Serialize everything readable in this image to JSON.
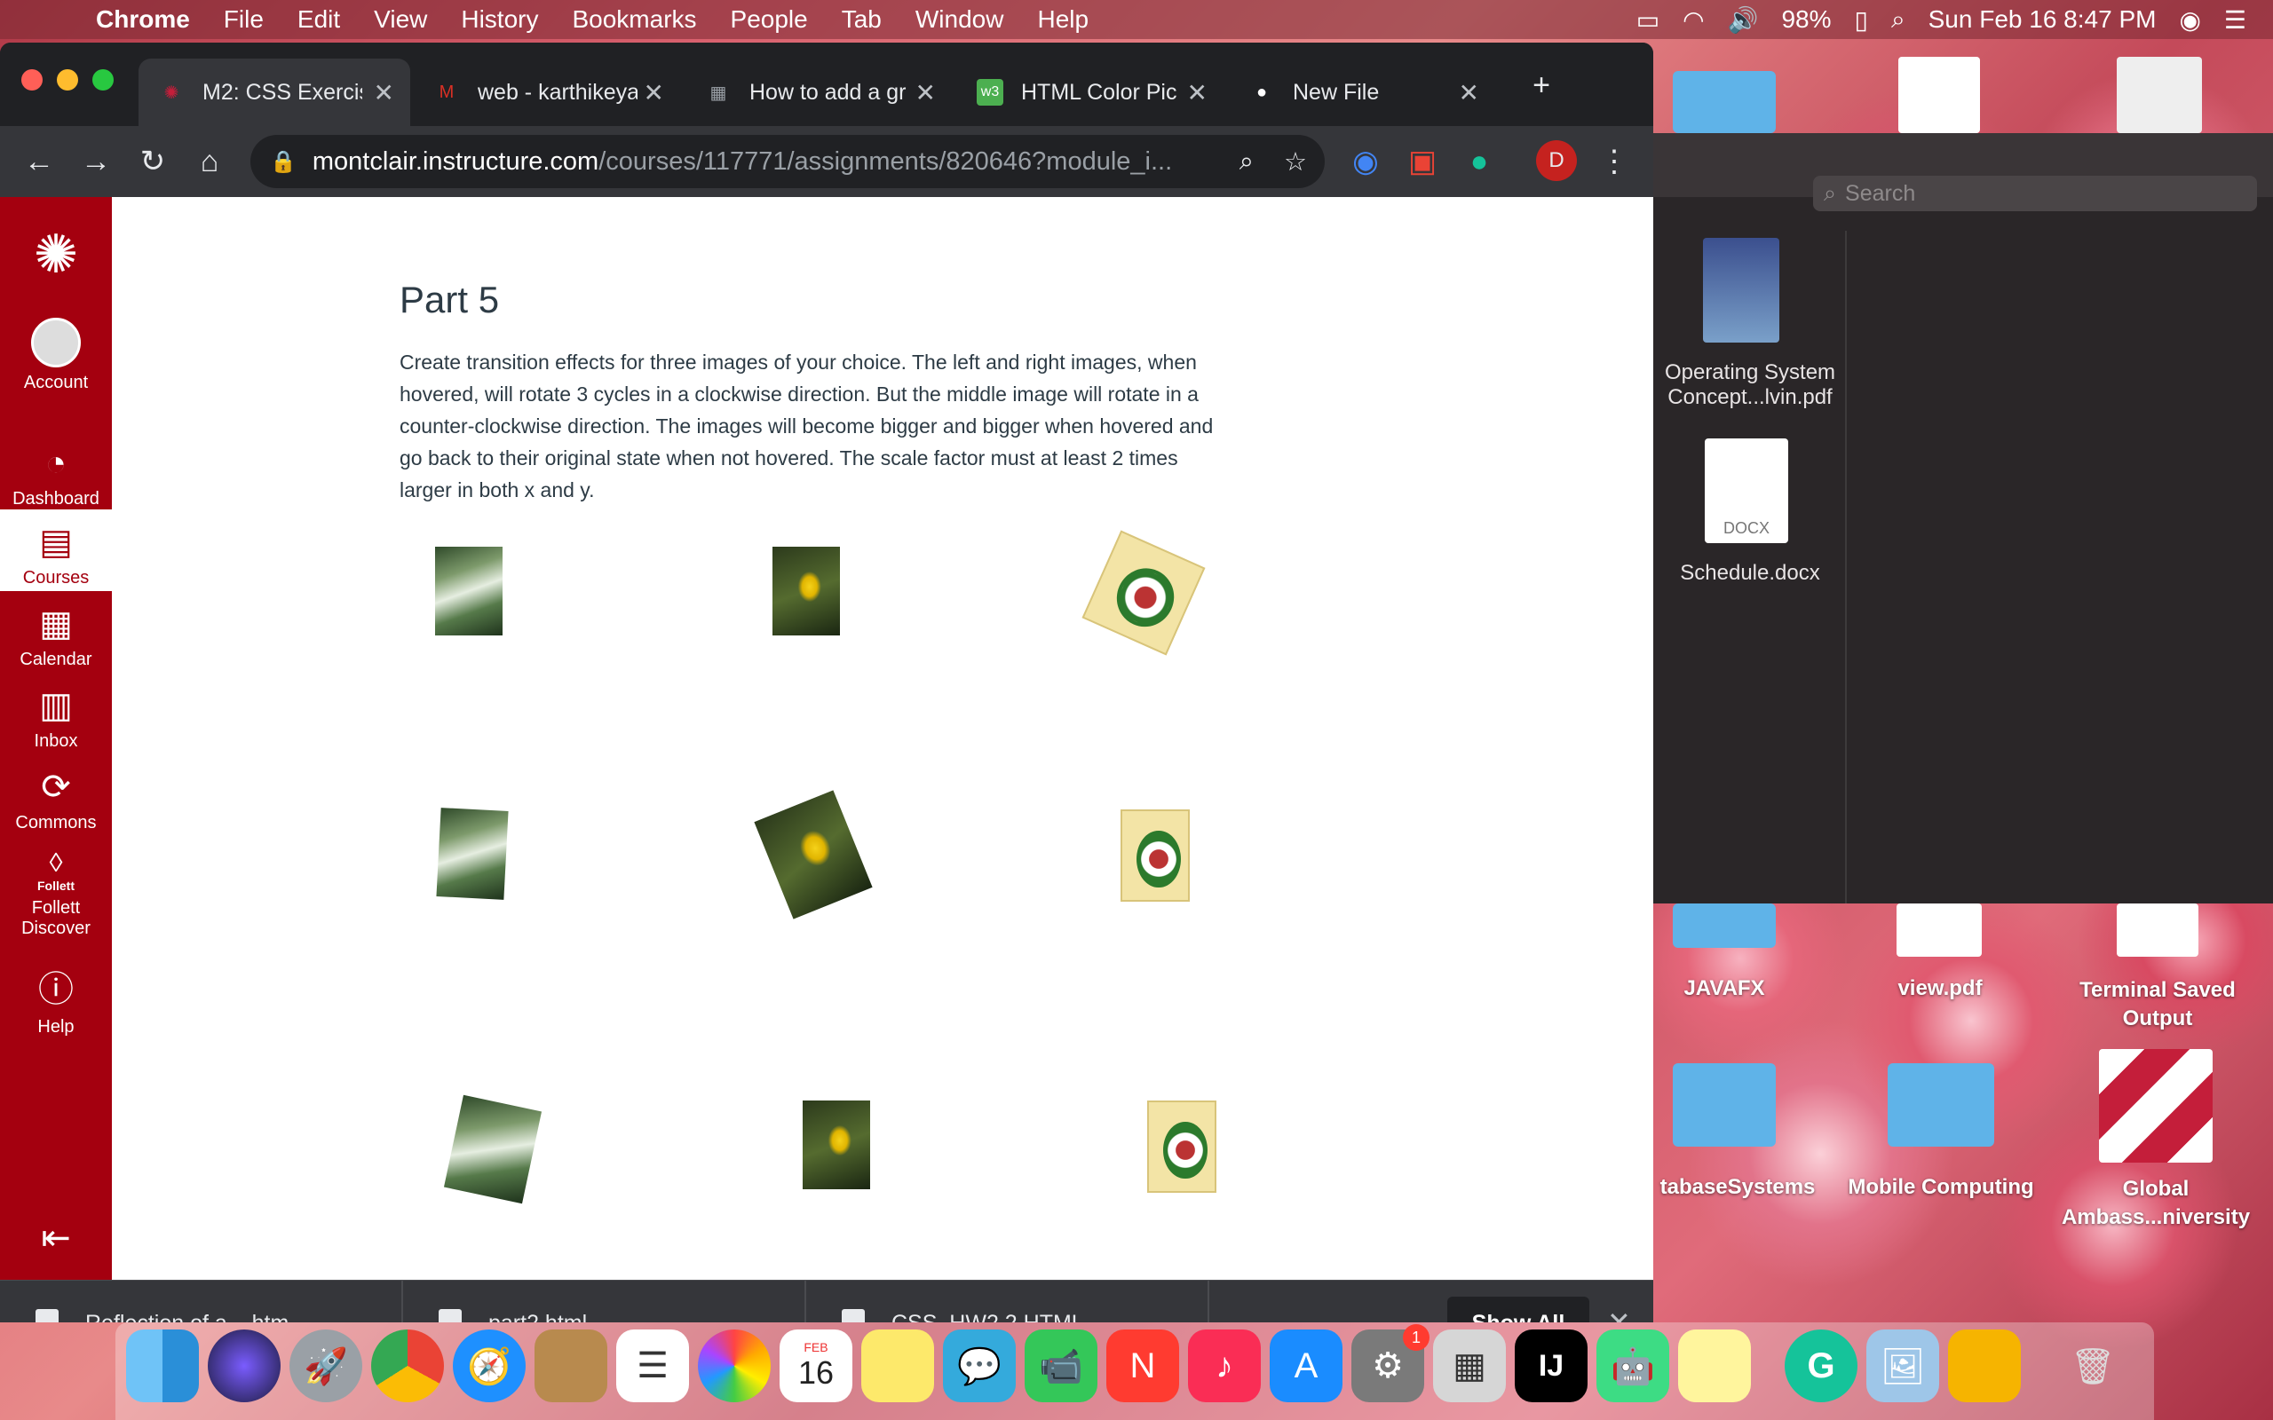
{
  "menubar": {
    "app": "Chrome",
    "items": [
      "File",
      "Edit",
      "View",
      "History",
      "Bookmarks",
      "People",
      "Tab",
      "Window",
      "Help"
    ],
    "battery": "98%",
    "datetime": "Sun Feb 16  8:47 PM"
  },
  "tabs": [
    {
      "title": "M2: CSS Exercis",
      "favicon_color": "#c41e3a"
    },
    {
      "title": "web - karthikeya",
      "favicon_color": "#d93025"
    },
    {
      "title": "How to add a gr",
      "favicon_color": "#5f6368"
    },
    {
      "title": "HTML Color Pic",
      "favicon_color": "#4caf50"
    },
    {
      "title": "New File",
      "favicon_color": "#ffffff"
    }
  ],
  "address": {
    "host": "montclair.instructure.com",
    "path": "/courses/117771/assignments/820646?module_i..."
  },
  "profile_initial": "D",
  "canvas_nav": [
    {
      "label": "Account"
    },
    {
      "label": "Dashboard"
    },
    {
      "label": "Courses"
    },
    {
      "label": "Calendar"
    },
    {
      "label": "Inbox"
    },
    {
      "label": "Commons"
    },
    {
      "label": "Follett Discover"
    },
    {
      "label": "Help"
    }
  ],
  "follett_logo_text": "Follett",
  "assignment": {
    "heading": "Part 5",
    "body": "Create transition effects for three images of your choice. The left and right images, when hovered, will rotate 3 cycles in a clockwise direction. But the middle image will rotate in a counter-clockwise direction. The images will become bigger and bigger when hovered and go back to their original state when not hovered. The scale factor must at least 2 times larger in both x and y."
  },
  "downloads": [
    {
      "name": "Reflection of a....htm"
    },
    {
      "name": "part2.html"
    },
    {
      "name": "CSS_HW2.2.HTML"
    }
  ],
  "show_all": "Show All",
  "finder": {
    "search_placeholder": "Search",
    "files": [
      {
        "name": "Operating System Concept...lvin.pdf"
      },
      {
        "name": "Schedule.docx",
        "badge": "DOCX"
      }
    ]
  },
  "desktop": [
    {
      "name": "JAVAFX"
    },
    {
      "name": "view.pdf"
    },
    {
      "name": "Terminal Saved Output"
    },
    {
      "name": "tabaseSystems"
    },
    {
      "name": "Mobile Computing"
    },
    {
      "name": "Global Ambass...niversity"
    }
  ],
  "dock": {
    "calendar_month": "FEB",
    "calendar_day": "16",
    "badge_count": "1"
  }
}
